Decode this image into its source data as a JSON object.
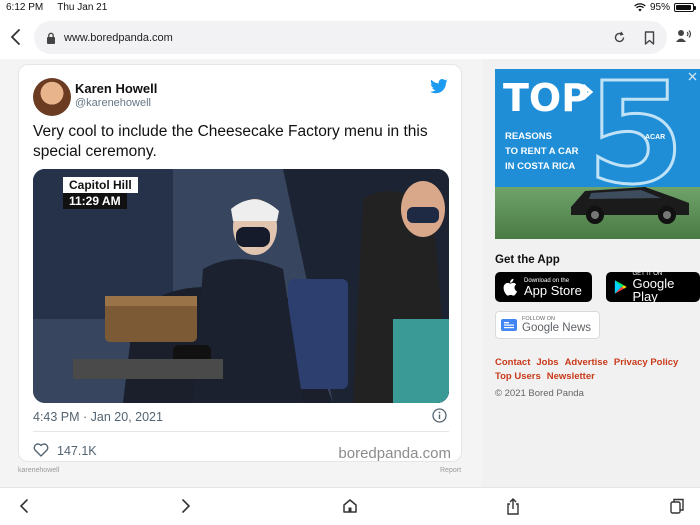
{
  "status_bar": {
    "time": "6:12 PM",
    "date": "Thu Jan 21",
    "battery": "95%",
    "battery_level": 0.95
  },
  "address_bar": {
    "url": "www.boredpanda.com"
  },
  "tweet": {
    "author_name": "Karen Howell",
    "author_handle": "@karenehowell",
    "text": "Very cool to include the Cheesecake Factory menu in this special ceremony.",
    "media": {
      "chyron_title": "Capitol Hill",
      "chyron_time": "11:29 AM"
    },
    "timestamp": "4:43 PM · Jan 20, 2021",
    "likes": "147.1K",
    "watermark": "boredpanda.com"
  },
  "credit": {
    "source": "karenehowell",
    "report": "Report"
  },
  "ad": {
    "headline": "TOP",
    "number": "5",
    "lines": [
      "REASONS",
      "TO RENT A CAR",
      "IN COSTA RICA"
    ],
    "brand": "ACAR"
  },
  "sidebar": {
    "get_app_title": "Get the App",
    "app_store": {
      "small": "Download on the",
      "big": "App Store"
    },
    "google_play": {
      "small": "GET IT ON",
      "big": "Google Play"
    },
    "google_news": {
      "small": "FOLLOW ON",
      "big": "Google News"
    },
    "links": [
      "Contact",
      "Jobs",
      "Advertise",
      "Privacy Policy",
      "Top Users",
      "Newsletter"
    ],
    "copyright": "© 2021 Bored Panda"
  },
  "colors": {
    "twitter_blue": "#1d9bf0",
    "link_red": "#c93a1a",
    "ad_blue": "#1f8ed6"
  }
}
